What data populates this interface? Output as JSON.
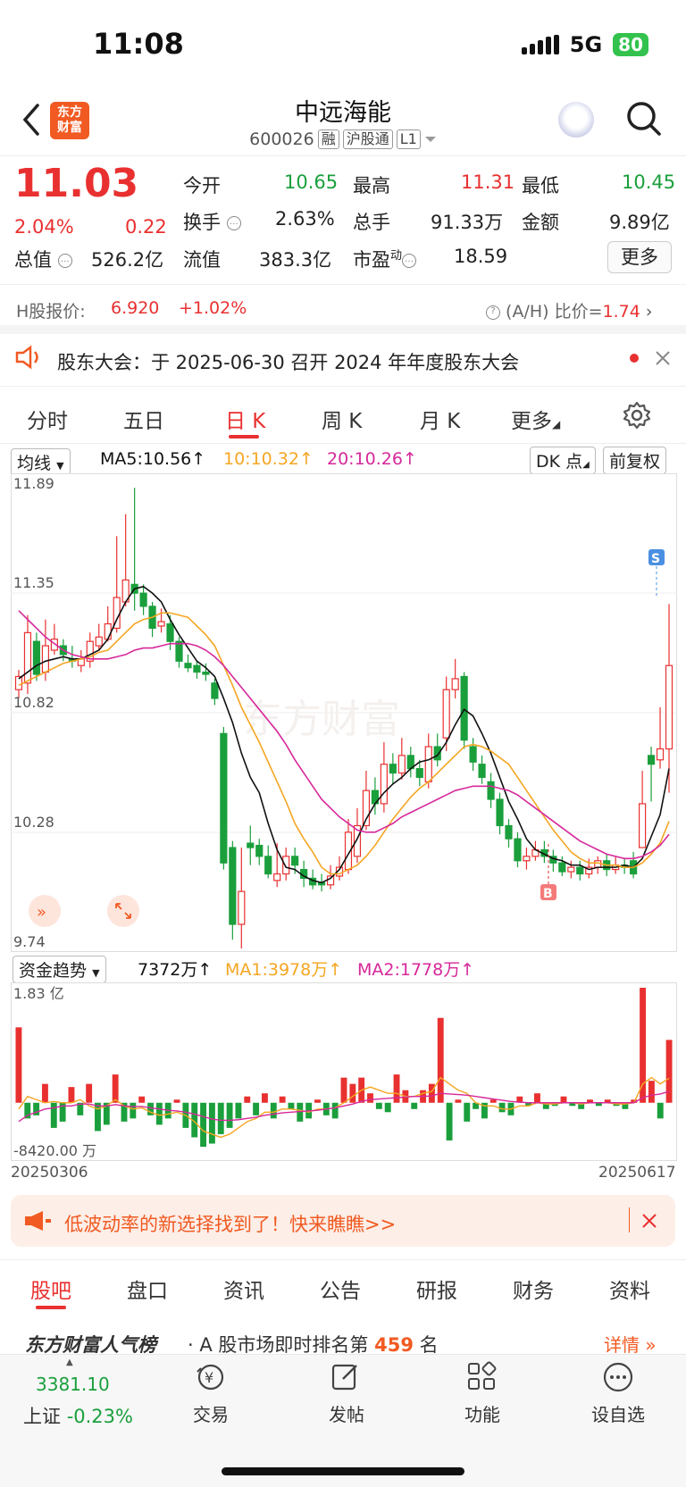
{
  "status": {
    "time": "11:08",
    "network": "5G",
    "battery": "80"
  },
  "header": {
    "title": "中远海能",
    "code": "600026",
    "tags": [
      "融",
      "沪股通",
      "L1"
    ]
  },
  "quote": {
    "price": "11.03",
    "pct": "2.04%",
    "chg": "0.22",
    "open_label": "今开",
    "open": "10.65",
    "high_label": "最高",
    "high": "11.31",
    "low_label": "最低",
    "low": "10.45",
    "turnover_label": "换手",
    "turnover": "2.63%",
    "volume_label": "总手",
    "volume": "91.33万",
    "amount_label": "金额",
    "amount": "9.89亿",
    "mktcap_label": "总值",
    "mktcap": "526.2亿",
    "float_label": "流值",
    "float": "383.3亿",
    "pe_label": "市盈",
    "pe_sup": "动",
    "pe": "18.59",
    "more": "更多"
  },
  "hshare": {
    "label": "H股报价:",
    "price": "6.920",
    "chg": "+1.02%",
    "ah_label": "(A/H) 比价=",
    "ah": "1.74"
  },
  "notice": {
    "text": "股东大会：于 2025-06-30 召开 2024 年年度股东大会"
  },
  "tabs": [
    "分时",
    "五日",
    "日 K",
    "周 K",
    "月 K",
    "更多"
  ],
  "kline_bar": {
    "selector": "均线",
    "ma5": "MA5:10.56",
    "ma10": "10:10.32",
    "ma20": "20:10.26",
    "dk": "DK 点",
    "adj": "前复权"
  },
  "axis": {
    "y_top": "11.89",
    "y2": "11.35",
    "y3": "10.82",
    "y4": "10.28",
    "y_bottom": "9.74",
    "s_marker": "S",
    "b_marker": "B",
    "watermark": "东方财富"
  },
  "fund_bar": {
    "selector": "资金趋势",
    "value": "7372万",
    "ma1": "MA1:3978万",
    "ma2": "MA2:1778万",
    "top": "1.83 亿",
    "bottom": "-8420.00 万",
    "date_start": "20250306",
    "date_end": "20250617"
  },
  "banner": {
    "text": "低波动率的新选择找到了！快来瞧瞧>>"
  },
  "subtabs": [
    "股吧",
    "盘口",
    "资讯",
    "公告",
    "研报",
    "财务",
    "资料"
  ],
  "rank": {
    "brand": "东方财富人气榜",
    "text": "· A 股市场即时排名第",
    "num": "459",
    "unit": "名",
    "detail": "详情"
  },
  "footer": {
    "index_value": "3381.10",
    "index_label": "上证",
    "index_chg": "-0.23%",
    "items": [
      "交易",
      "发帖",
      "功能",
      "设自选"
    ]
  },
  "colors": {
    "up": "#e93030",
    "down": "#1a9f3c",
    "ma5": "#111111",
    "ma10": "#f5a623",
    "ma20": "#d6289a"
  },
  "chart_data": {
    "type": "candlestick",
    "ylim": [
      9.74,
      11.89
    ],
    "candles": [
      [
        10.92,
        10.98,
        11.01,
        10.88
      ],
      [
        10.95,
        11.18,
        11.26,
        10.9
      ],
      [
        11.14,
        10.99,
        11.18,
        10.96
      ],
      [
        11.0,
        11.12,
        11.24,
        10.96
      ],
      [
        11.1,
        11.15,
        11.22,
        11.08
      ],
      [
        11.12,
        11.08,
        11.15,
        11.05
      ],
      [
        11.06,
        11.05,
        11.12,
        11.02
      ],
      [
        11.03,
        11.06,
        11.1,
        11.0
      ],
      [
        11.05,
        11.14,
        11.18,
        11.02
      ],
      [
        11.12,
        11.16,
        11.22,
        11.1
      ],
      [
        11.15,
        11.22,
        11.3,
        11.14
      ],
      [
        11.2,
        11.34,
        11.62,
        11.18
      ],
      [
        11.32,
        11.42,
        11.72,
        11.3
      ],
      [
        11.4,
        11.36,
        11.84,
        11.28
      ],
      [
        11.36,
        11.3,
        11.4,
        11.26
      ],
      [
        11.3,
        11.2,
        11.32,
        11.16
      ],
      [
        11.21,
        11.23,
        11.29,
        11.18
      ],
      [
        11.22,
        11.14,
        11.26,
        11.1
      ],
      [
        11.14,
        11.05,
        11.16,
        11.02
      ],
      [
        11.04,
        11.02,
        11.08,
        11.0
      ],
      [
        11.03,
        11.0,
        11.05,
        10.97
      ],
      [
        11.0,
        10.99,
        11.04,
        10.96
      ],
      [
        10.95,
        10.88,
        10.97,
        10.85
      ],
      [
        10.72,
        10.13,
        10.75,
        10.1
      ],
      [
        10.2,
        9.85,
        10.23,
        9.78
      ],
      [
        9.85,
        10.0,
        10.2,
        9.74
      ],
      [
        10.22,
        10.2,
        10.3,
        10.12
      ],
      [
        10.21,
        10.16,
        10.24,
        10.12
      ],
      [
        10.16,
        10.08,
        10.21,
        10.06
      ],
      [
        10.05,
        10.08,
        10.22,
        10.02
      ],
      [
        10.08,
        10.16,
        10.2,
        10.05
      ],
      [
        10.16,
        10.12,
        10.2,
        10.08
      ],
      [
        10.1,
        10.06,
        10.14,
        10.02
      ],
      [
        10.06,
        10.03,
        10.1,
        10.01
      ],
      [
        10.04,
        10.03,
        10.08,
        10.0
      ],
      [
        10.03,
        10.07,
        10.12,
        10.01
      ],
      [
        10.07,
        10.11,
        10.16,
        10.05
      ],
      [
        10.1,
        10.27,
        10.33,
        10.08
      ],
      [
        10.16,
        10.3,
        10.38,
        10.13
      ],
      [
        10.3,
        10.46,
        10.55,
        10.28
      ],
      [
        10.46,
        10.4,
        10.52,
        10.35
      ],
      [
        10.4,
        10.58,
        10.68,
        10.36
      ],
      [
        10.58,
        10.54,
        10.63,
        10.49
      ],
      [
        10.54,
        10.62,
        10.7,
        10.51
      ],
      [
        10.62,
        10.56,
        10.66,
        10.52
      ],
      [
        10.56,
        10.52,
        10.6,
        10.48
      ],
      [
        10.5,
        10.66,
        10.72,
        10.47
      ],
      [
        10.66,
        10.6,
        10.72,
        10.57
      ],
      [
        10.7,
        10.92,
        10.98,
        10.64
      ],
      [
        10.92,
        10.97,
        11.06,
        10.88
      ],
      [
        10.98,
        10.69,
        11.0,
        10.65
      ],
      [
        10.66,
        10.59,
        10.7,
        10.55
      ],
      [
        10.58,
        10.52,
        10.62,
        10.49
      ],
      [
        10.5,
        10.42,
        10.54,
        10.38
      ],
      [
        10.42,
        10.3,
        10.45,
        10.26
      ],
      [
        10.3,
        10.24,
        10.33,
        10.2
      ],
      [
        10.24,
        10.14,
        10.27,
        10.11
      ],
      [
        10.14,
        10.16,
        10.2,
        10.1
      ],
      [
        10.16,
        10.19,
        10.23,
        10.14
      ],
      [
        10.19,
        10.16,
        10.23,
        10.13
      ],
      [
        10.16,
        10.13,
        10.19,
        10.09
      ],
      [
        10.13,
        10.09,
        10.16,
        10.07
      ],
      [
        10.09,
        10.11,
        10.14,
        10.06
      ],
      [
        10.11,
        10.08,
        10.14,
        10.05
      ],
      [
        10.08,
        10.11,
        10.15,
        10.06
      ],
      [
        10.11,
        10.14,
        10.16,
        10.08
      ],
      [
        10.14,
        10.1,
        10.17,
        10.07
      ],
      [
        10.1,
        10.12,
        10.16,
        10.08
      ],
      [
        10.12,
        10.11,
        10.15,
        10.08
      ],
      [
        10.14,
        10.08,
        10.18,
        10.06
      ],
      [
        10.2,
        10.4,
        10.55,
        10.22
      ],
      [
        10.62,
        10.58,
        10.66,
        10.41
      ],
      [
        10.6,
        10.65,
        10.84,
        10.56
      ],
      [
        10.65,
        11.03,
        11.31,
        10.45
      ]
    ],
    "ma5": [
      10.97,
      11.0,
      11.03,
      11.05,
      11.06,
      11.07,
      11.06,
      11.06,
      11.08,
      11.1,
      11.15,
      11.24,
      11.32,
      11.38,
      11.39,
      11.36,
      11.32,
      11.24,
      11.17,
      11.11,
      11.05,
      11.02,
      10.98,
      10.88,
      10.77,
      10.63,
      10.52,
      10.45,
      10.31,
      10.19,
      10.11,
      10.1,
      10.07,
      10.05,
      10.04,
      10.06,
      10.1,
      10.17,
      10.24,
      10.33,
      10.4,
      10.45,
      10.49,
      10.52,
      10.56,
      10.59,
      10.6,
      10.62,
      10.68,
      10.76,
      10.83,
      10.8,
      10.72,
      10.63,
      10.52,
      10.41,
      10.33,
      10.24,
      10.19,
      10.17,
      10.15,
      10.14,
      10.12,
      10.12,
      10.1,
      10.11,
      10.11,
      10.11,
      10.12,
      10.11,
      10.15,
      10.25,
      10.35,
      10.56
    ],
    "ma10": [
      10.94,
      10.96,
      10.98,
      11.0,
      11.02,
      11.04,
      11.05,
      11.06,
      11.07,
      11.09,
      11.1,
      11.14,
      11.18,
      11.22,
      11.24,
      11.25,
      11.27,
      11.27,
      11.26,
      11.25,
      11.21,
      11.17,
      11.12,
      11.03,
      10.94,
      10.84,
      10.76,
      10.68,
      10.59,
      10.5,
      10.41,
      10.31,
      10.24,
      10.18,
      10.11,
      10.08,
      10.08,
      10.1,
      10.12,
      10.16,
      10.21,
      10.27,
      10.33,
      10.38,
      10.43,
      10.47,
      10.5,
      10.54,
      10.58,
      10.62,
      10.66,
      10.67,
      10.66,
      10.64,
      10.61,
      10.58,
      10.52,
      10.46,
      10.4,
      10.34,
      10.28,
      10.23,
      10.18,
      10.15,
      10.13,
      10.13,
      10.12,
      10.12,
      10.11,
      10.11,
      10.13,
      10.17,
      10.22,
      10.32
    ],
    "ma20": [
      11.28,
      11.24,
      11.2,
      11.16,
      11.13,
      11.1,
      11.08,
      11.07,
      11.06,
      11.06,
      11.06,
      11.07,
      11.08,
      11.1,
      11.11,
      11.11,
      11.12,
      11.13,
      11.13,
      11.13,
      11.12,
      11.1,
      11.07,
      11.03,
      10.98,
      10.93,
      10.88,
      10.83,
      10.78,
      10.73,
      10.67,
      10.6,
      10.54,
      10.48,
      10.42,
      10.38,
      10.34,
      10.31,
      10.28,
      10.27,
      10.27,
      10.29,
      10.31,
      10.34,
      10.36,
      10.38,
      10.4,
      10.42,
      10.44,
      10.46,
      10.47,
      10.48,
      10.48,
      10.48,
      10.47,
      10.46,
      10.44,
      10.41,
      10.38,
      10.35,
      10.32,
      10.29,
      10.26,
      10.23,
      10.21,
      10.19,
      10.17,
      10.16,
      10.15,
      10.15,
      10.16,
      10.18,
      10.21,
      10.26
    ],
    "fund_flow": [
      1.2,
      -0.25,
      -0.2,
      0.3,
      -0.4,
      -0.3,
      0.25,
      -0.2,
      0.3,
      -0.45,
      -0.35,
      0.45,
      -0.3,
      -0.25,
      0.1,
      -0.2,
      -0.35,
      -0.25,
      0.05,
      -0.4,
      -0.55,
      -0.7,
      -0.65,
      -0.5,
      -0.4,
      -0.25,
      0.1,
      -0.2,
      0.15,
      -0.25,
      0.1,
      -0.1,
      -0.3,
      -0.25,
      0.05,
      -0.2,
      -0.25,
      0.4,
      0.3,
      0.4,
      0.15,
      -0.1,
      -0.15,
      0.45,
      0.2,
      -0.1,
      0.2,
      0.3,
      1.35,
      -0.6,
      0.05,
      -0.3,
      -0.1,
      -0.25,
      0.05,
      -0.15,
      -0.2,
      0.1,
      -0.05,
      0.15,
      -0.1,
      -0.05,
      0.1,
      -0.05,
      -0.1,
      0.05,
      -0.05,
      0.05,
      -0.05,
      -0.1,
      0.05,
      1.83,
      0.35,
      -0.25,
      1.0
    ],
    "fund_ma1": [
      -0.1,
      0.1,
      0.05,
      0.0,
      0.02,
      0.0,
      0.0,
      0.05,
      -0.05,
      -0.1,
      -0.05,
      0.05,
      -0.05,
      -0.1,
      -0.08,
      -0.15,
      -0.2,
      -0.18,
      -0.15,
      -0.2,
      -0.3,
      -0.45,
      -0.5,
      -0.55,
      -0.5,
      -0.4,
      -0.3,
      -0.25,
      -0.15,
      -0.15,
      -0.1,
      -0.1,
      -0.12,
      -0.15,
      -0.1,
      -0.1,
      -0.08,
      0.0,
      0.1,
      0.2,
      0.25,
      0.2,
      0.15,
      0.15,
      0.1,
      0.1,
      0.15,
      0.18,
      0.4,
      0.3,
      0.2,
      0.15,
      0.0,
      -0.05,
      -0.05,
      -0.1,
      -0.1,
      -0.05,
      -0.05,
      0.0,
      -0.02,
      -0.02,
      0.0,
      0.0,
      -0.02,
      0.0,
      0.0,
      0.0,
      -0.02,
      -0.02,
      0.0,
      0.3,
      0.4,
      0.3,
      0.39
    ],
    "fund_ma2": [
      -0.3,
      -0.2,
      -0.15,
      -0.1,
      -0.08,
      -0.05,
      -0.05,
      -0.02,
      -0.02,
      -0.05,
      -0.05,
      -0.03,
      -0.05,
      -0.06,
      -0.06,
      -0.08,
      -0.1,
      -0.12,
      -0.13,
      -0.15,
      -0.18,
      -0.22,
      -0.26,
      -0.28,
      -0.28,
      -0.27,
      -0.25,
      -0.23,
      -0.2,
      -0.18,
      -0.16,
      -0.15,
      -0.14,
      -0.13,
      -0.12,
      -0.1,
      -0.08,
      -0.05,
      -0.02,
      0.02,
      0.05,
      0.06,
      0.07,
      0.08,
      0.09,
      0.1,
      0.1,
      0.11,
      0.15,
      0.14,
      0.13,
      0.12,
      0.1,
      0.08,
      0.06,
      0.04,
      0.02,
      0.01,
      0.0,
      0.0,
      0.0,
      0.0,
      0.0,
      0.0,
      0.0,
      0.0,
      0.0,
      0.0,
      0.0,
      0.0,
      0.0,
      0.08,
      0.12,
      0.14,
      0.18
    ],
    "fund_range": [
      -0.842,
      1.83
    ]
  }
}
